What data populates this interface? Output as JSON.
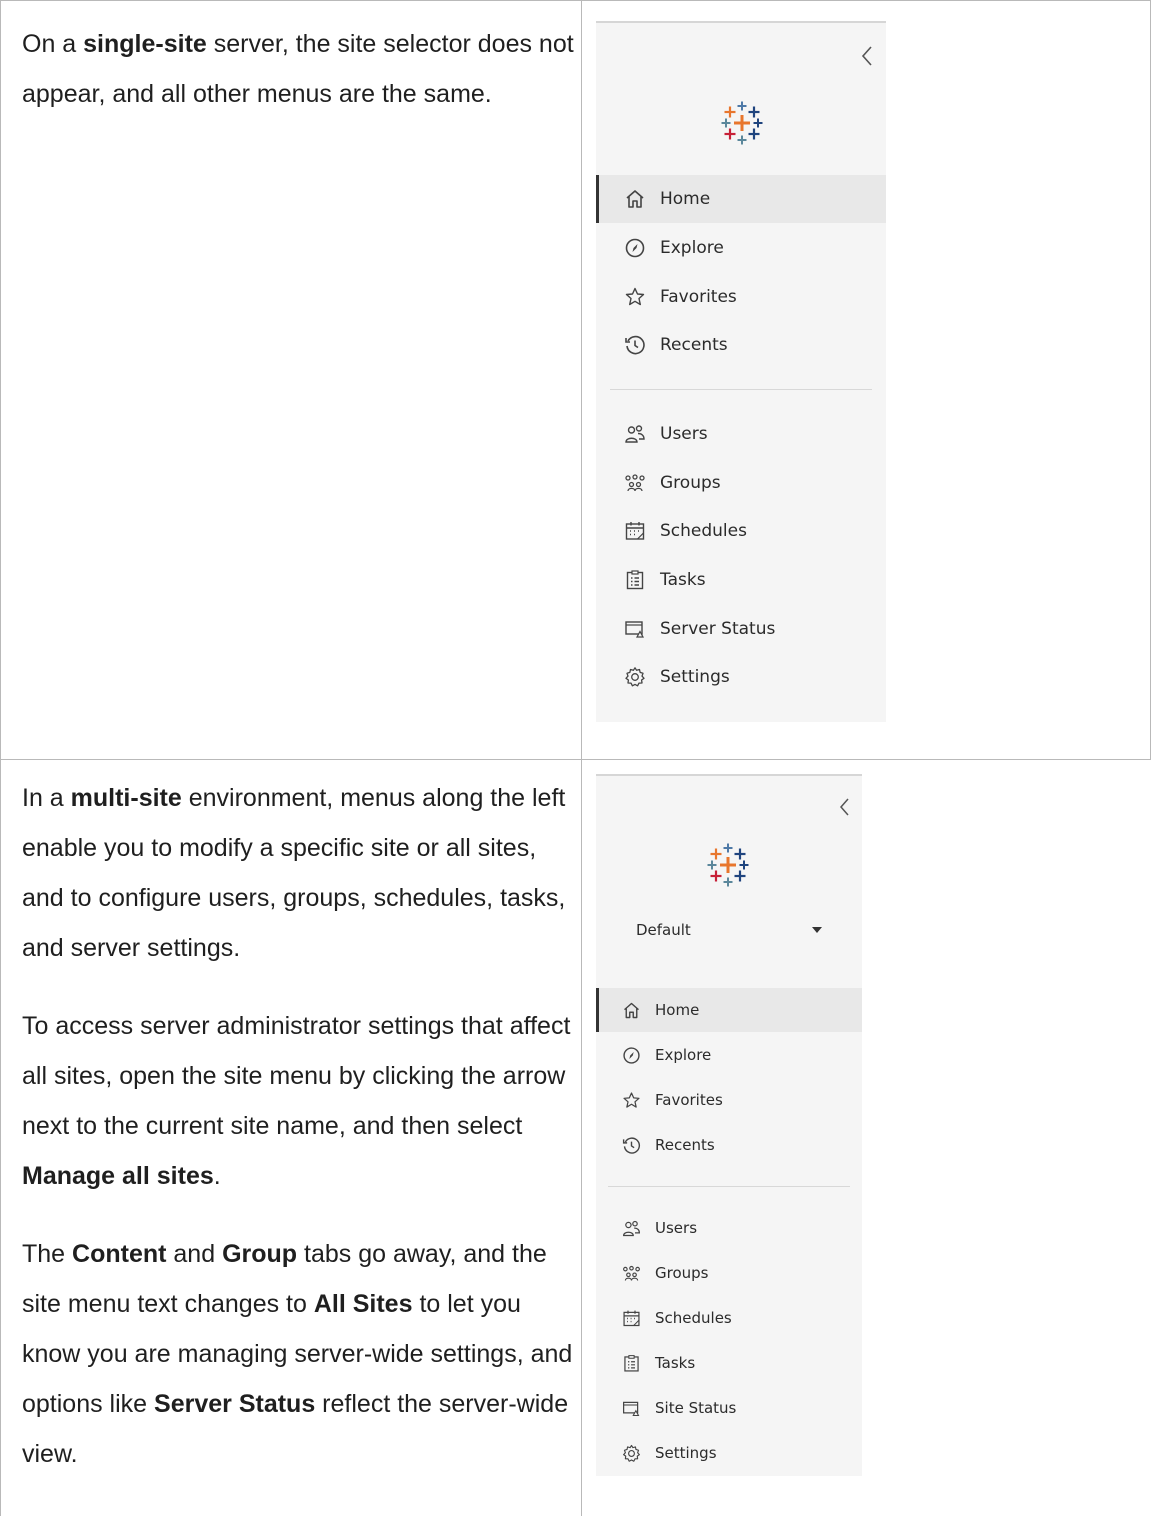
{
  "row1": {
    "text": {
      "p1_a": "On a ",
      "p1_b": "single-site",
      "p1_c": " server, the site selector does not appear, and all other menus are the same."
    },
    "nav_primary": [
      {
        "label": "Home",
        "icon": "home-icon",
        "active": true
      },
      {
        "label": "Explore",
        "icon": "compass-icon",
        "active": false
      },
      {
        "label": "Favorites",
        "icon": "star-icon",
        "active": false
      },
      {
        "label": "Recents",
        "icon": "history-icon",
        "active": false
      }
    ],
    "nav_admin": [
      {
        "label": "Users",
        "icon": "users-icon"
      },
      {
        "label": "Groups",
        "icon": "groups-icon"
      },
      {
        "label": "Schedules",
        "icon": "calendar-icon"
      },
      {
        "label": "Tasks",
        "icon": "tasks-icon"
      },
      {
        "label": "Server Status",
        "icon": "server-status-icon"
      },
      {
        "label": "Settings",
        "icon": "gear-icon"
      }
    ]
  },
  "row2": {
    "text": {
      "p1_a": "In a ",
      "p1_b": "multi-site",
      "p1_c": " environment, menus along the left enable you to modify a specific site or all sites, and to configure users, groups, schedules, tasks, and server settings.",
      "p2_a": "To access server administrator settings that affect all sites, open the site menu by clicking the arrow next to the current site name, and then select ",
      "p2_b": "Manage all sites",
      "p2_c": ".",
      "p3_a": "The ",
      "p3_b": "Content",
      "p3_c": " and ",
      "p3_d": "Group",
      "p3_e": " tabs go away, and the site menu text changes to ",
      "p3_f": "All Sites",
      "p3_g": " to let you know you are managing server-wide settings, and options like ",
      "p3_h": "Server Status",
      "p3_i": " reflect the server-wide view."
    },
    "site_selector": {
      "value": "Default"
    },
    "nav_primary": [
      {
        "label": "Home",
        "icon": "home-icon",
        "active": true
      },
      {
        "label": "Explore",
        "icon": "compass-icon",
        "active": false
      },
      {
        "label": "Favorites",
        "icon": "star-icon",
        "active": false
      },
      {
        "label": "Recents",
        "icon": "history-icon",
        "active": false
      }
    ],
    "nav_admin": [
      {
        "label": "Users",
        "icon": "users-icon"
      },
      {
        "label": "Groups",
        "icon": "groups-icon"
      },
      {
        "label": "Schedules",
        "icon": "calendar-icon"
      },
      {
        "label": "Tasks",
        "icon": "tasks-icon"
      },
      {
        "label": "Site Status",
        "icon": "server-status-icon"
      },
      {
        "label": "Settings",
        "icon": "gear-icon"
      }
    ]
  },
  "colors": {
    "sidebar_bg": "#f5f5f5",
    "active_bg": "#e8e8e8",
    "border": "#b9b9b9",
    "logo_blue": "#1f447e",
    "logo_orange": "#e8762d",
    "logo_red": "#c72037",
    "logo_teal": "#5b879b",
    "logo_purple": "#5c6692",
    "logo_lightblue": "#4e79a7"
  }
}
